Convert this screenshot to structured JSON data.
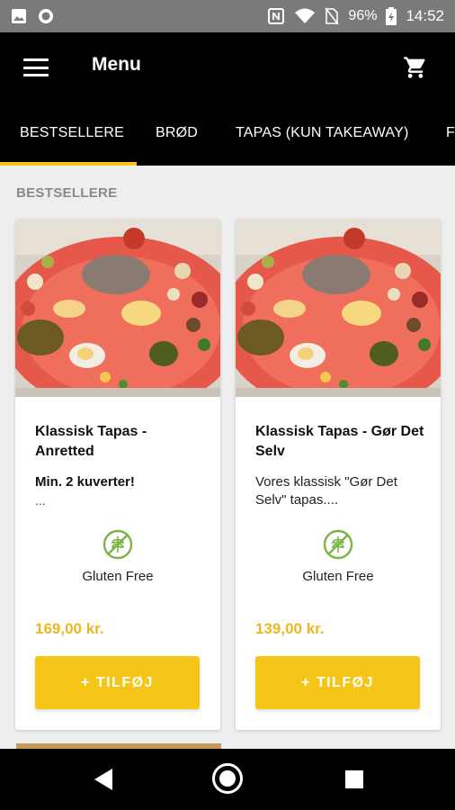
{
  "status_bar": {
    "battery": "96%",
    "time": "14:52",
    "icons": [
      "image-icon",
      "record-icon",
      "nfc-icon",
      "wifi-icon",
      "no-sim-icon",
      "battery-icon"
    ]
  },
  "app_bar": {
    "title": "Menu",
    "icons": [
      "hamburger-menu-icon",
      "shopping-cart-icon"
    ]
  },
  "tabs": [
    {
      "label": "BESTSELLERE",
      "active": true
    },
    {
      "label": "BRØD",
      "active": false
    },
    {
      "label": "TAPAS (KUN TAKEAWAY)",
      "active": false
    },
    {
      "label": "F",
      "active": false
    }
  ],
  "section": {
    "title": "BESTSELLERE"
  },
  "products": [
    {
      "title": "Klassisk Tapas - Anretted",
      "description": "Min. 2 kuverter!",
      "description_bold": true,
      "ellipsis": "...",
      "badge_label": "Gluten Free",
      "price": "169,00 kr.",
      "button_label": "+ TILFØJ"
    },
    {
      "title": "Klassisk Tapas - Gør Det Selv",
      "description": "Vores klassisk \"Gør Det Selv\" tapas....",
      "description_bold": false,
      "ellipsis": "",
      "badge_label": "Gluten Free",
      "price": "139,00 kr.",
      "button_label": "+ TILFØJ"
    }
  ],
  "colors": {
    "accent": "#f5c518",
    "price": "#e8b923",
    "app_bar": "#000000",
    "background": "#eeeeee",
    "gluten_free_green": "#7cb342"
  },
  "nav_bar": {
    "icons": [
      "back-icon",
      "home-icon",
      "recents-icon"
    ]
  }
}
